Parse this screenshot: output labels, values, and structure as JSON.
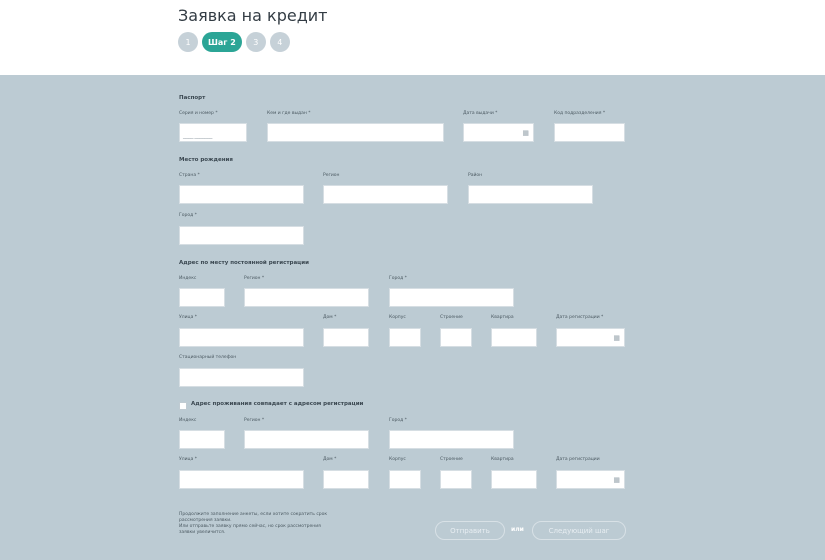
{
  "header": {
    "title": "Заявка на кредит",
    "steps": [
      "1",
      "Шаг 2",
      "3",
      "4"
    ]
  },
  "passport": {
    "section": "Паспорт",
    "series_label": "Серия и номер *",
    "series_mask": "____ _______",
    "issued_by_label": "Кем и где выдан *",
    "issue_date_label": "Дата выдачи *",
    "division_code_label": "Код подразделения *"
  },
  "birthplace": {
    "section": "Место рождения",
    "country_label": "Страна *",
    "region_label": "Регион",
    "district_label": "Район",
    "city_label": "Город *"
  },
  "registration": {
    "section": "Адрес по месту постоянной регистрации",
    "index_label": "Индекс",
    "region_label": "Регион *",
    "city_label": "Город *",
    "street_label": "Улица *",
    "house_label": "Дом *",
    "building_label": "Корпус",
    "structure_label": "Строение",
    "apartment_label": "Квартира",
    "reg_date_label": "Дата регистрации *",
    "phone_label": "Стационарный телефон"
  },
  "residence": {
    "same_address_label": "Адрес проживания совпадает с адресом регистрации",
    "index_label": "Индекс",
    "region_label": "Регион *",
    "city_label": "Город *",
    "street_label": "Улица *",
    "house_label": "Дом *",
    "building_label": "Корпус",
    "structure_label": "Строение",
    "apartment_label": "Квартира",
    "reg_date_label": "Дата регистрации"
  },
  "footer": {
    "note_line1": "Продолжите заполнение анкеты, если хотите сократить срок",
    "note_line2": "рассмотрения заявки.",
    "note_line3": "Или отправьте заявку прямо сейчас, но срок рассмотрения",
    "note_line4": "заявки увеличится.",
    "submit_label": "Отправить",
    "or_label": "или",
    "next_label": "Следующий шаг"
  },
  "icons": {
    "calendar": "calendar-icon"
  },
  "colors": {
    "accent": "#2ba596",
    "panel": "#bccbd3",
    "step_inactive": "#c6d1d8"
  }
}
